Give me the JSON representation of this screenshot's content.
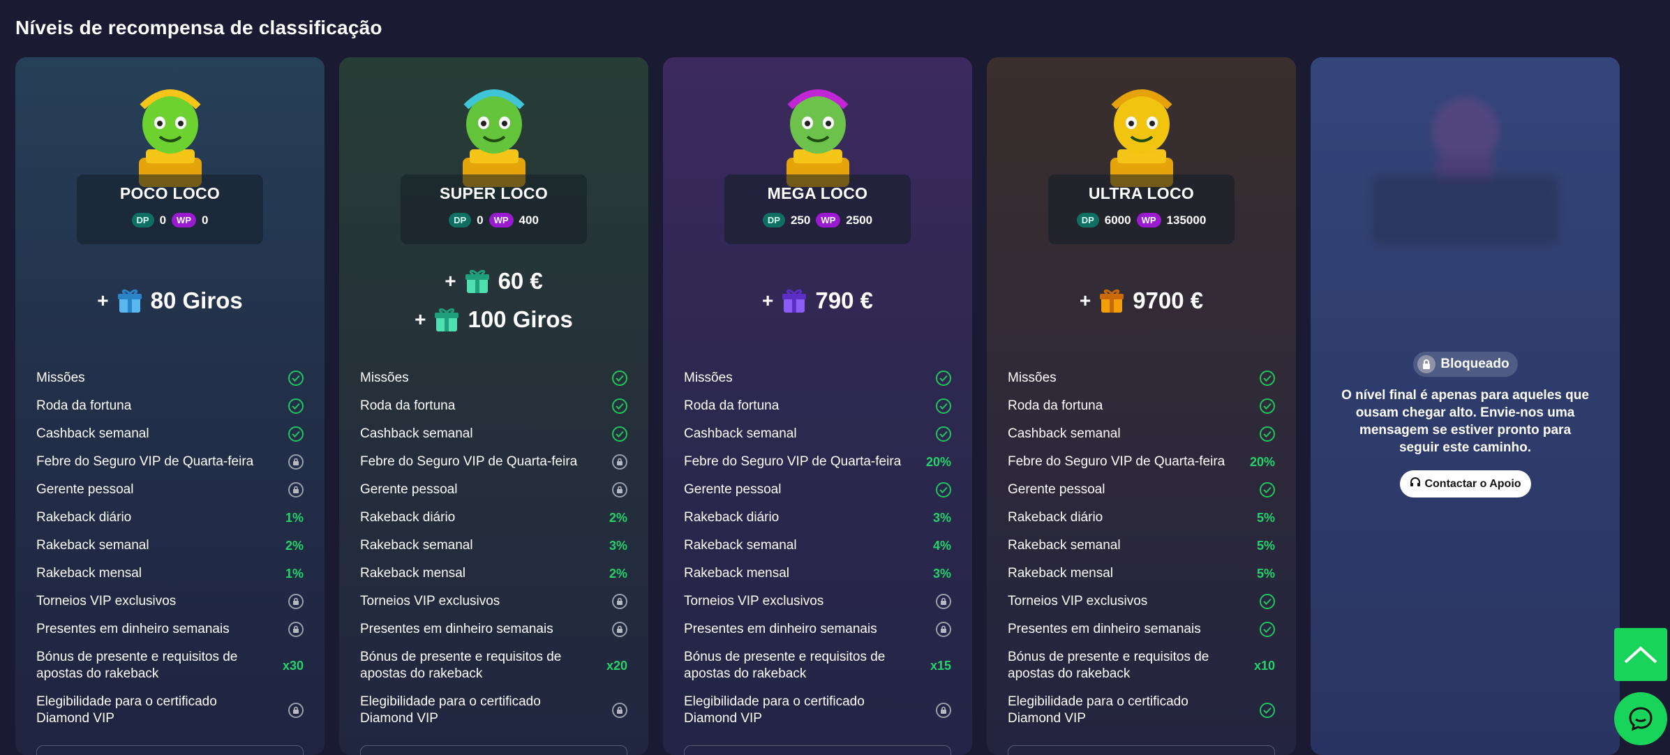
{
  "page_title": "Níveis de recompensa de classificação",
  "colors": {
    "check": "#22c55e",
    "value": "#22d46a",
    "dp": "#0f6f63",
    "wp": "#9a1ad0",
    "accent": "#18d45a"
  },
  "tiers": [
    {
      "name": "POCO LOCO",
      "dp_label": "DP",
      "dp": "0",
      "wp_label": "WP",
      "wp": "0",
      "rewards": [
        {
          "plus": "+",
          "text": "80 Giros",
          "gift": "blue"
        }
      ],
      "features": [
        "check",
        "check",
        "check",
        "lock",
        "lock",
        "1%",
        "2%",
        "1%",
        "lock",
        "lock",
        "x30",
        "lock"
      ]
    },
    {
      "name": "SUPER LOCO",
      "dp_label": "DP",
      "dp": "0",
      "wp_label": "WP",
      "wp": "400",
      "rewards": [
        {
          "plus": "+",
          "text": "60 €",
          "gift": "teal"
        },
        {
          "plus": "+",
          "text": "100 Giros",
          "gift": "teal"
        }
      ],
      "features": [
        "check",
        "check",
        "check",
        "lock",
        "lock",
        "2%",
        "3%",
        "2%",
        "lock",
        "lock",
        "x20",
        "lock"
      ]
    },
    {
      "name": "MEGA LOCO",
      "dp_label": "DP",
      "dp": "250",
      "wp_label": "WP",
      "wp": "2500",
      "rewards": [
        {
          "plus": "+",
          "text": "790 €",
          "gift": "purple"
        }
      ],
      "features": [
        "check",
        "check",
        "check",
        "20%",
        "check",
        "3%",
        "4%",
        "3%",
        "lock",
        "lock",
        "x15",
        "lock"
      ]
    },
    {
      "name": "ULTRA LOCO",
      "dp_label": "DP",
      "dp": "6000",
      "wp_label": "WP",
      "wp": "135000",
      "rewards": [
        {
          "plus": "+",
          "text": "9700 €",
          "gift": "orange"
        }
      ],
      "features": [
        "check",
        "check",
        "check",
        "20%",
        "check",
        "5%",
        "5%",
        "5%",
        "check",
        "check",
        "x10",
        "check"
      ]
    }
  ],
  "feature_labels": [
    "Missões",
    "Roda da fortuna",
    "Cashback semanal",
    "Febre do Seguro VIP de Quarta-feira",
    "Gerente pessoal",
    "Rakeback diário",
    "Rakeback semanal",
    "Rakeback mensal",
    "Torneios VIP exclusivos",
    "Presentes em dinheiro semanais",
    "Bónus de presente e requisitos de apostas do rakeback",
    "Elegibilidade para o certificado Diamond VIP"
  ],
  "locked_tier": {
    "badge": "Bloqueado",
    "message": "O nível final é apenas para aqueles que ousam chegar alto. Envie-nos uma mensagem se estiver pronto para seguir este caminho.",
    "button": "Contactar o Apoio"
  },
  "icons": {
    "scroll_top": "chevron-up-icon",
    "chat": "chat-bubble-icon"
  }
}
